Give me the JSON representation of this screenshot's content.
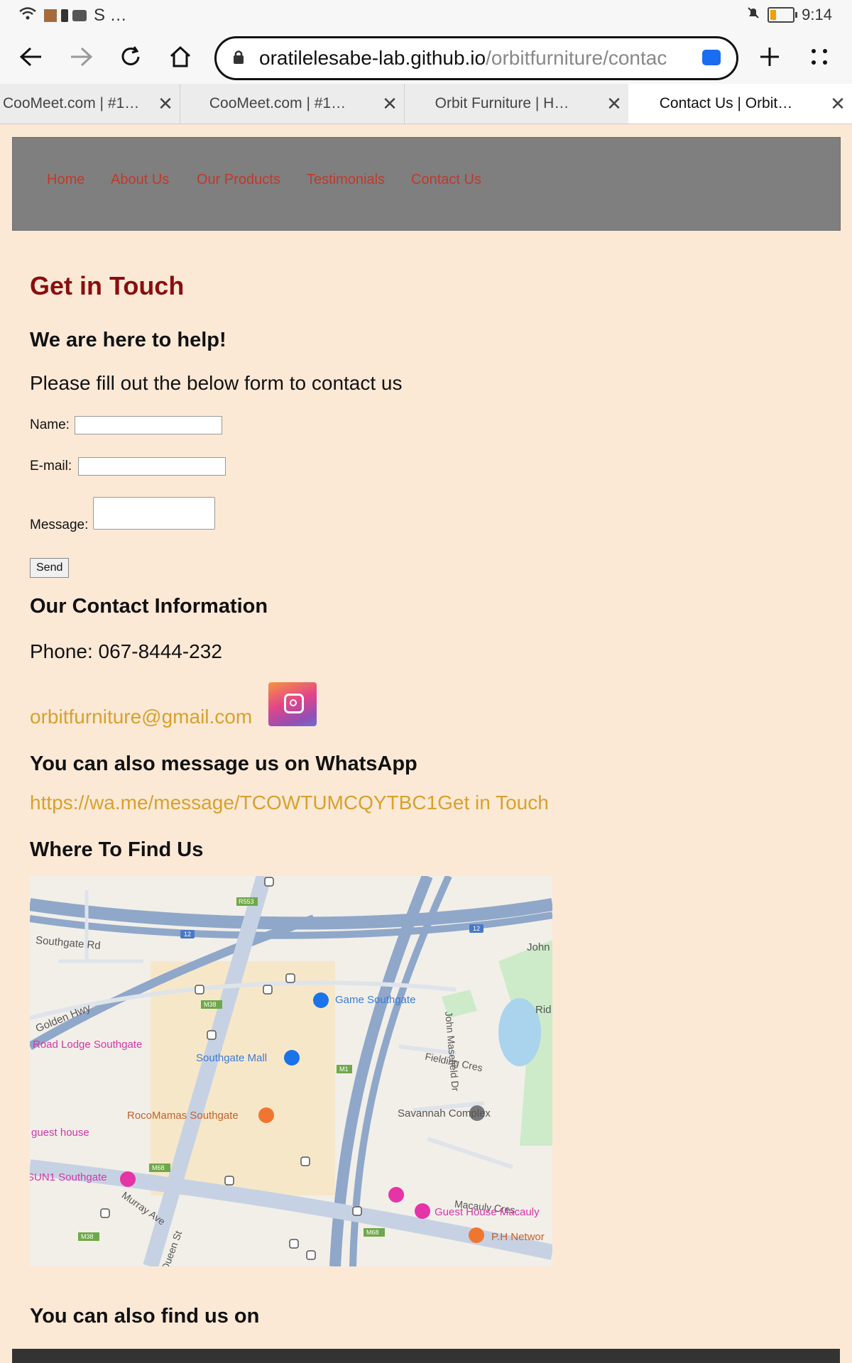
{
  "status": {
    "time": "9:14",
    "app_icons_text": "S …"
  },
  "browser": {
    "url_host": "oratilelesabe-lab.github.io",
    "url_path": "/orbitfurniture/contac",
    "tabs": [
      {
        "label": "CooMeet.com | #1…"
      },
      {
        "label": "CooMeet.com | #1…"
      },
      {
        "label": "Orbit Furniture | H…"
      },
      {
        "label": "Contact Us | Orbit…"
      }
    ]
  },
  "nav": {
    "items": [
      "Home",
      "About Us",
      "Our Products",
      "Testimonials",
      "Contact Us"
    ]
  },
  "page": {
    "title": "Get in Touch",
    "subtitle": "We are here to help!",
    "intro": "Please fill out the below form to contact us",
    "form": {
      "name_label": "Name:",
      "email_label": "E-mail:",
      "message_label": "Message:",
      "send_label": "Send"
    },
    "contact_heading": "Our Contact Information",
    "phone": "Phone: 067-8444-232",
    "email": "orbitfurniture@gmail.com",
    "whatsapp_heading": "You can also message us on WhatsApp",
    "whatsapp_link": "https://wa.me/message/TCOWTUMCQYTBC1Get in Touch",
    "find_heading": "Where To Find Us",
    "also_find": "You can also find us on"
  },
  "map": {
    "labels": {
      "southgate_rd": "Southgate Rd",
      "golden_hwy": "Golden Hwy",
      "road_lodge": "Road Lodge Southgate",
      "rocomamas": "RocoMamas Southgate",
      "guest_house": "guest house",
      "sun1": "SUN1 Southgate",
      "murray": "Murray Ave",
      "queen": "Queen St",
      "game": "Game Southgate",
      "mall": "Southgate Mall",
      "fielding": "Fielding Cres",
      "savannah": "Savannah Complex",
      "macauly_cres": "Macauly Cres",
      "guest_macauly": "Guest House Macauly",
      "ph_network": "P.H Networ",
      "masefield": "John Masefield Dr",
      "john": "John",
      "rid": "Rid",
      "r553": "R553",
      "r12a": "12",
      "r12b": "12",
      "m38": "M38",
      "m1": "M1",
      "m68a": "M68",
      "m68b": "M68",
      "m38b": "M38"
    }
  },
  "colors": {
    "page_bg": "#fbe9d6",
    "nav_bg": "#7f7f7f",
    "nav_link": "#c0392b",
    "title": "#8b0e0e",
    "link": "#d9a12c"
  }
}
